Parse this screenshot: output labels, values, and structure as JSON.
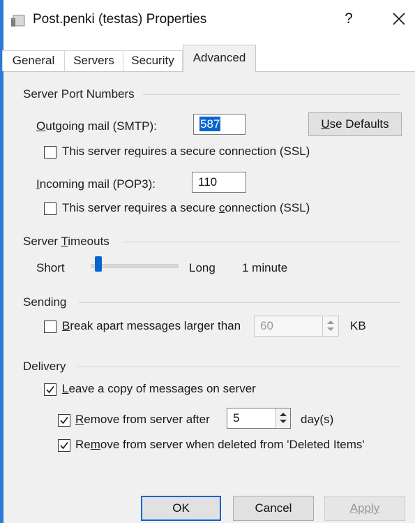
{
  "window": {
    "title": "Post.penki (testas) Properties",
    "help_label": "?",
    "close_label": "✕",
    "icon": "mail-account-icon"
  },
  "tabs": [
    {
      "label": "General",
      "active": false
    },
    {
      "label": "Servers",
      "active": false
    },
    {
      "label": "Security",
      "active": false
    },
    {
      "label": "Advanced",
      "active": true
    }
  ],
  "ports": {
    "group_label": "Server Port Numbers",
    "smtp_label_key": "O",
    "smtp_label_rest": "utgoing mail (SMTP):",
    "smtp_value": "587",
    "use_defaults_key": "U",
    "use_defaults_rest": "se Defaults",
    "smtp_ssl_label_a": "This server re",
    "smtp_ssl_label_key": "q",
    "smtp_ssl_label_b": "uires a secure connection (SSL)",
    "smtp_ssl_checked": false,
    "pop3_label_key": "I",
    "pop3_label_rest": "ncoming mail (POP3):",
    "pop3_value": "110",
    "pop3_ssl_label_a": "This server requires a secure ",
    "pop3_ssl_label_key": "c",
    "pop3_ssl_label_b": "onnection (SSL)",
    "pop3_ssl_checked": false
  },
  "timeouts": {
    "group_label_a": "Server ",
    "group_label_key": "T",
    "group_label_b": "imeouts",
    "short_label": "Short",
    "long_label": "Long",
    "value_text": "1 minute",
    "slider_level": 0.05
  },
  "sending": {
    "group_label": "Sending",
    "break_label_key": "B",
    "break_label_rest": "reak apart messages larger than",
    "break_checked": false,
    "size_value": "60",
    "unit": "KB"
  },
  "delivery": {
    "group_label": "Delivery",
    "leave_copy_key": "L",
    "leave_copy_rest": "eave a copy of messages on server",
    "leave_copy_checked": true,
    "remove_after_key": "R",
    "remove_after_rest": "emove from server after",
    "remove_after_checked": true,
    "days_value": "5",
    "days_unit": "day(s)",
    "remove_deleted_a": "Re",
    "remove_deleted_key": "m",
    "remove_deleted_b": "ove from server when deleted from 'Deleted Items'",
    "remove_deleted_checked": true
  },
  "footer": {
    "ok_label": "OK",
    "cancel_label": "Cancel",
    "apply_label": "Apply"
  },
  "colors": {
    "accent": "#0a64d0",
    "window_border": "#2b7ad7",
    "face": "#f0f0f0",
    "disabled_text": "#9a9a9a"
  }
}
